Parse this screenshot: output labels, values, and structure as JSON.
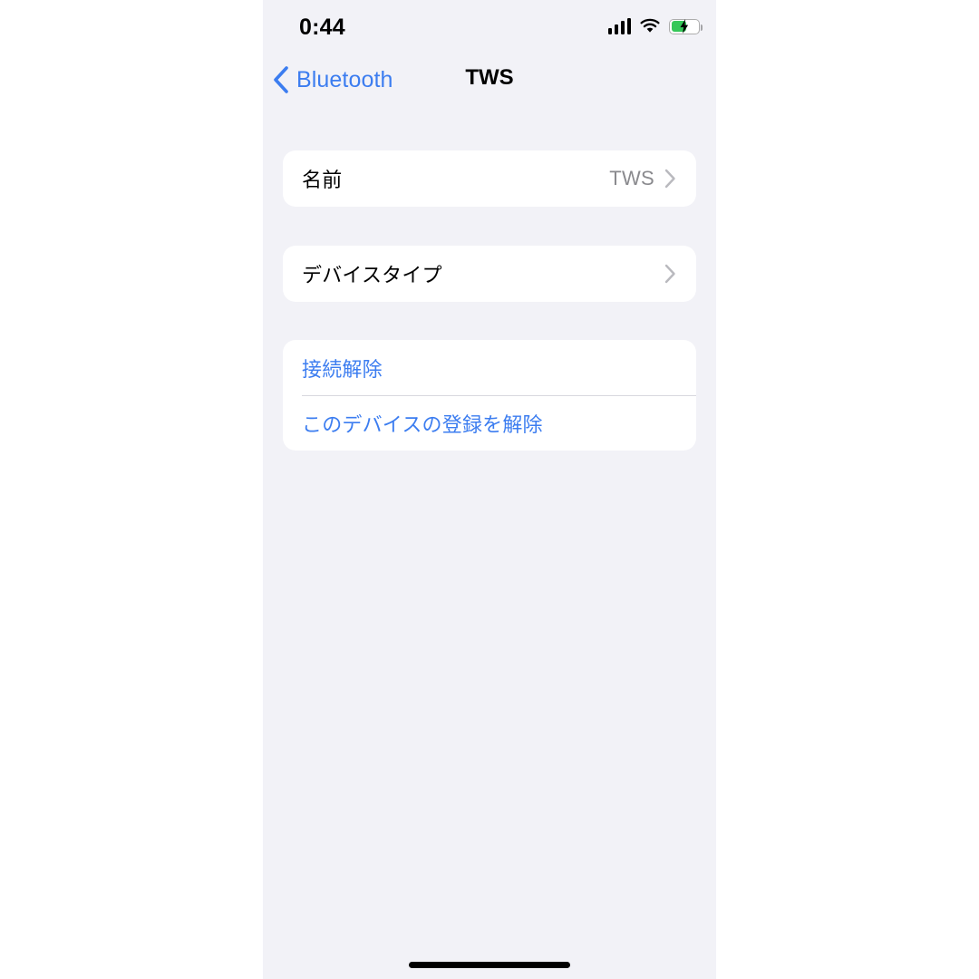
{
  "status_bar": {
    "time": "0:44",
    "cellular_icon": "signal-bars-icon",
    "cellular_bars_filled": 4,
    "wifi_icon": "wifi-icon",
    "battery_icon": "battery-charging-icon",
    "battery_level_percent": 50,
    "battery_charging": true,
    "battery_fill_color": "#35C759"
  },
  "nav": {
    "back_icon": "chevron-left-icon",
    "back_label": "Bluetooth",
    "title": "TWS",
    "accent_color": "#3C7DF0"
  },
  "groups": [
    {
      "id": "name-group",
      "rows": [
        {
          "label": "名前",
          "value": "TWS",
          "accessory_icon": "chevron-right-icon",
          "style": "value"
        }
      ]
    },
    {
      "id": "device-type-group",
      "rows": [
        {
          "label": "デバイスタイプ",
          "value": "",
          "accessory_icon": "chevron-right-icon",
          "style": "plain"
        }
      ]
    },
    {
      "id": "actions-group",
      "rows": [
        {
          "label": "接続解除",
          "value": "",
          "accessory_icon": "",
          "style": "link"
        },
        {
          "label": "このデバイスの登録を解除",
          "value": "",
          "accessory_icon": "",
          "style": "link"
        }
      ]
    }
  ],
  "home_indicator": {
    "icon": "home-indicator-bar"
  },
  "colors": {
    "page_background": "#F2F2F7",
    "card_background": "#FFFFFF",
    "separator": "#D8D8DE",
    "primary_text": "#000000",
    "secondary_text": "#8A8A8E",
    "link_blue": "#3C7DF0"
  }
}
